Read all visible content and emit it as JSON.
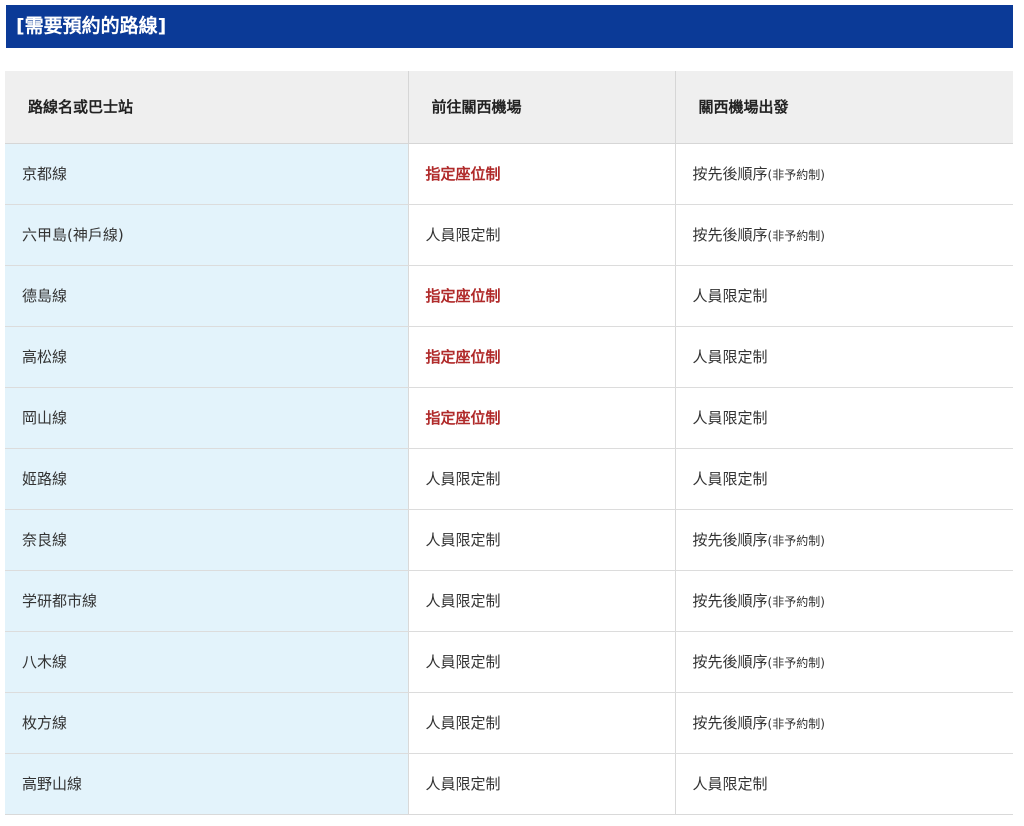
{
  "header": {
    "title": "[需要預約的路線]"
  },
  "table": {
    "columns": [
      "路線名或巴士站",
      "前往關西機場",
      "關西機場出發"
    ],
    "rows": [
      {
        "route": "京都線",
        "to_airport": "指定座位制",
        "to_airport_reserved": true,
        "from_airport": "按先後順序",
        "from_airport_note": "(非予約制)",
        "from_airport_reserved": false
      },
      {
        "route": "六甲島(神戶線)",
        "to_airport": "人員限定制",
        "to_airport_reserved": false,
        "from_airport": "按先後順序",
        "from_airport_note": "(非予約制)",
        "from_airport_reserved": false
      },
      {
        "route": "德島線",
        "to_airport": "指定座位制",
        "to_airport_reserved": true,
        "from_airport": "人員限定制",
        "from_airport_note": "",
        "from_airport_reserved": false
      },
      {
        "route": "高松線",
        "to_airport": "指定座位制",
        "to_airport_reserved": true,
        "from_airport": "人員限定制",
        "from_airport_note": "",
        "from_airport_reserved": false
      },
      {
        "route": "岡山線",
        "to_airport": "指定座位制",
        "to_airport_reserved": true,
        "from_airport": "人員限定制",
        "from_airport_note": "",
        "from_airport_reserved": false
      },
      {
        "route": "姬路線",
        "to_airport": "人員限定制",
        "to_airport_reserved": false,
        "from_airport": "人員限定制",
        "from_airport_note": "",
        "from_airport_reserved": false
      },
      {
        "route": "奈良線",
        "to_airport": "人員限定制",
        "to_airport_reserved": false,
        "from_airport": "按先後順序",
        "from_airport_note": "(非予約制)",
        "from_airport_reserved": false
      },
      {
        "route": "学研都市線",
        "to_airport": "人員限定制",
        "to_airport_reserved": false,
        "from_airport": "按先後順序",
        "from_airport_note": "(非予約制)",
        "from_airport_reserved": false
      },
      {
        "route": "八木線",
        "to_airport": "人員限定制",
        "to_airport_reserved": false,
        "from_airport": "按先後順序",
        "from_airport_note": "(非予約制)",
        "from_airport_reserved": false
      },
      {
        "route": "枚方線",
        "to_airport": "人員限定制",
        "to_airport_reserved": false,
        "from_airport": "按先後順序",
        "from_airport_note": "(非予約制)",
        "from_airport_reserved": false
      },
      {
        "route": "高野山線",
        "to_airport": "人員限定制",
        "to_airport_reserved": false,
        "from_airport": "人員限定制",
        "from_airport_note": "",
        "from_airport_reserved": false
      }
    ]
  },
  "colors": {
    "header_bg": "#0b3a97",
    "reserved_text": "#b02a2a",
    "route_cell_bg": "#e3f3fb",
    "table_head_bg": "#efefef"
  }
}
